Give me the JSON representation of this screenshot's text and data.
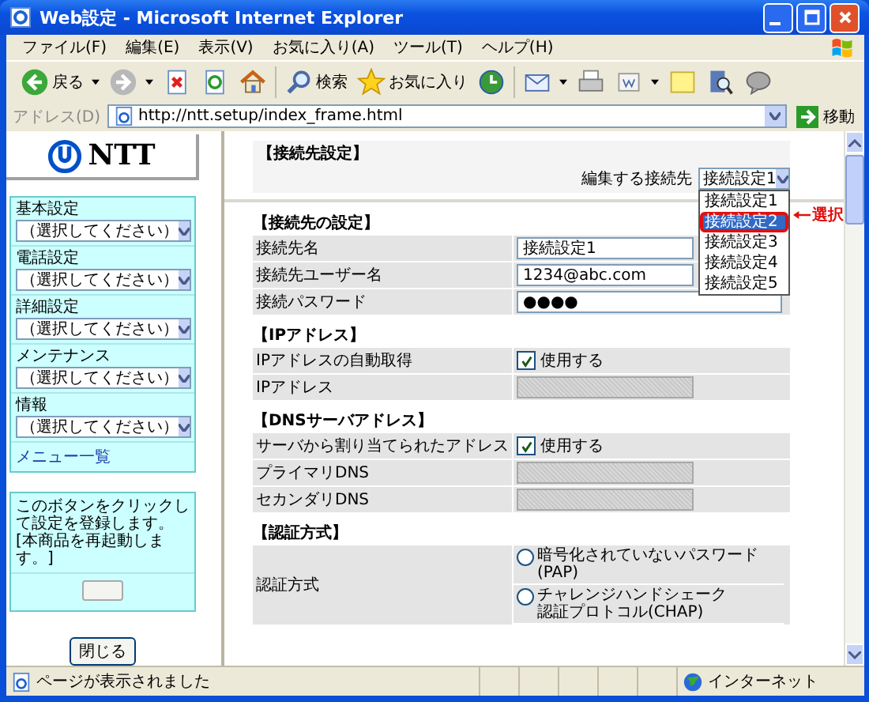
{
  "window": {
    "title": "Web設定 - Microsoft Internet Explorer"
  },
  "menu_bar": [
    "ファイル(F)",
    "編集(E)",
    "表示(V)",
    "お気に入り(A)",
    "ツール(T)",
    "ヘルプ(H)"
  ],
  "toolbar": [
    {
      "kind": "back",
      "label": "戻る",
      "menu": true
    },
    {
      "kind": "forward",
      "menu": true
    },
    {
      "kind": "stop",
      "menu": false
    },
    {
      "kind": "refresh",
      "menu": false
    },
    {
      "kind": "home",
      "menu": false
    },
    {
      "kind": "search",
      "label": "検索",
      "menu": false
    },
    {
      "kind": "favorites",
      "label": "お気に入り",
      "menu": false
    },
    {
      "kind": "history",
      "menu": false
    },
    {
      "kind": "mail",
      "menu": true
    },
    {
      "kind": "print",
      "menu": false
    },
    {
      "kind": "edit",
      "menu": true
    },
    {
      "kind": "note",
      "menu": false
    },
    {
      "kind": "research",
      "menu": false
    },
    {
      "kind": "chat",
      "menu": false
    }
  ],
  "address_bar": {
    "label": "アドレス(D)",
    "url": "http://ntt.setup/index_frame.html",
    "go": "移動"
  },
  "sidebar": {
    "logo": "NTT",
    "menus": [
      {
        "label": "基本設定",
        "value": "（選択してください）"
      },
      {
        "label": "電話設定",
        "value": "（選択してください）"
      },
      {
        "label": "詳細設定",
        "value": "（選択してください）"
      },
      {
        "label": "メンテナンス",
        "value": "（選択してください）"
      },
      {
        "label": "情報",
        "value": "（選択してください）"
      }
    ],
    "link": "メニュー一覧",
    "notice": "このボタンをクリックして設定を登録します。[本商品を再起動します。]",
    "close": "閉じる"
  },
  "main": {
    "header": "【接続先設定】",
    "edit_label": "編集する接続先",
    "edit_value": "接続設定1",
    "options": [
      {
        "label": "接続設定1",
        "selected": false
      },
      {
        "label": "接続設定2",
        "selected": true
      },
      {
        "label": "接続設定3",
        "selected": false
      },
      {
        "label": "接続設定4",
        "selected": false
      },
      {
        "label": "接続設定5",
        "selected": false
      }
    ],
    "callout": "選択",
    "sections": [
      {
        "title": "【接続先の設定】",
        "rows": [
          {
            "label": "接続先名",
            "kind": "text",
            "value": "接続設定1"
          },
          {
            "label": "接続先ユーザー名",
            "kind": "text",
            "value": "1234@abc.com"
          },
          {
            "label": "接続パスワード",
            "kind": "password",
            "value": "●●●●"
          }
        ]
      },
      {
        "title": "【IPアドレス】",
        "rows": [
          {
            "label": "IPアドレスの自動取得",
            "kind": "checkbox",
            "checked": true,
            "option": "使用する"
          },
          {
            "label": "IPアドレス",
            "kind": "disabled"
          }
        ]
      },
      {
        "title": "【DNSサーバアドレス】",
        "rows": [
          {
            "label": "サーバから割り当てられたアドレス",
            "kind": "checkbox",
            "checked": true,
            "option": "使用する"
          },
          {
            "label": "プライマリDNS",
            "kind": "disabled"
          },
          {
            "label": "セカンダリDNS",
            "kind": "disabled"
          }
        ]
      },
      {
        "title": "【認証方式】",
        "rows": [
          {
            "label": "認証方式",
            "kind": "radio",
            "options": [
              {
                "lines": [
                  "暗号化されていないパスワード",
                  "(PAP)"
                ],
                "selected": false
              },
              {
                "lines": [
                  "チャレンジハンドシェーク",
                  "認証プロトコル(CHAP)"
                ],
                "selected": false
              }
            ]
          }
        ]
      }
    ]
  },
  "status_bar": {
    "text": "ページが表示されました",
    "zone": "インターネット"
  }
}
